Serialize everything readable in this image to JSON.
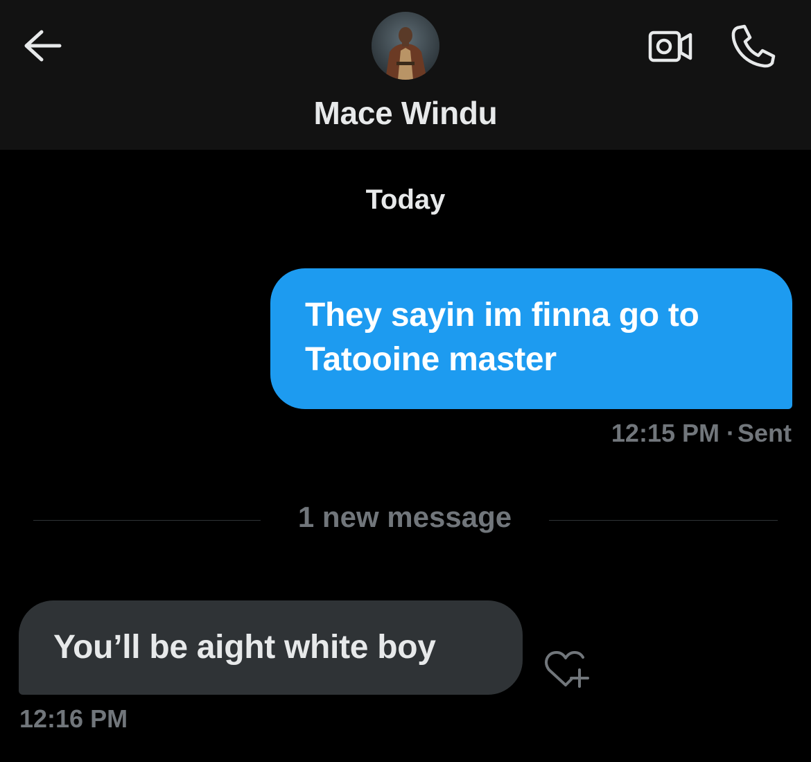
{
  "header": {
    "contact_name": "Mace Windu",
    "back_icon": "arrow-left-icon",
    "video_icon": "video-call-icon",
    "phone_icon": "phone-icon"
  },
  "conversation": {
    "date_label": "Today",
    "sent_message": {
      "text": "They sayin im finna go to Tatooine master",
      "time": "12:15 PM",
      "separator": "·",
      "status": "Sent"
    },
    "new_messages_divider": "1 new message",
    "received_message": {
      "text": "You’ll be aight white boy",
      "time": "12:16 PM",
      "reaction_icon": "heart-plus-icon"
    }
  },
  "colors": {
    "background": "#000000",
    "header_background": "#121212",
    "sent_bubble": "#1d9bf0",
    "received_bubble": "#2f3336",
    "primary_text": "#e7e9ea",
    "secondary_text": "#71767b"
  }
}
